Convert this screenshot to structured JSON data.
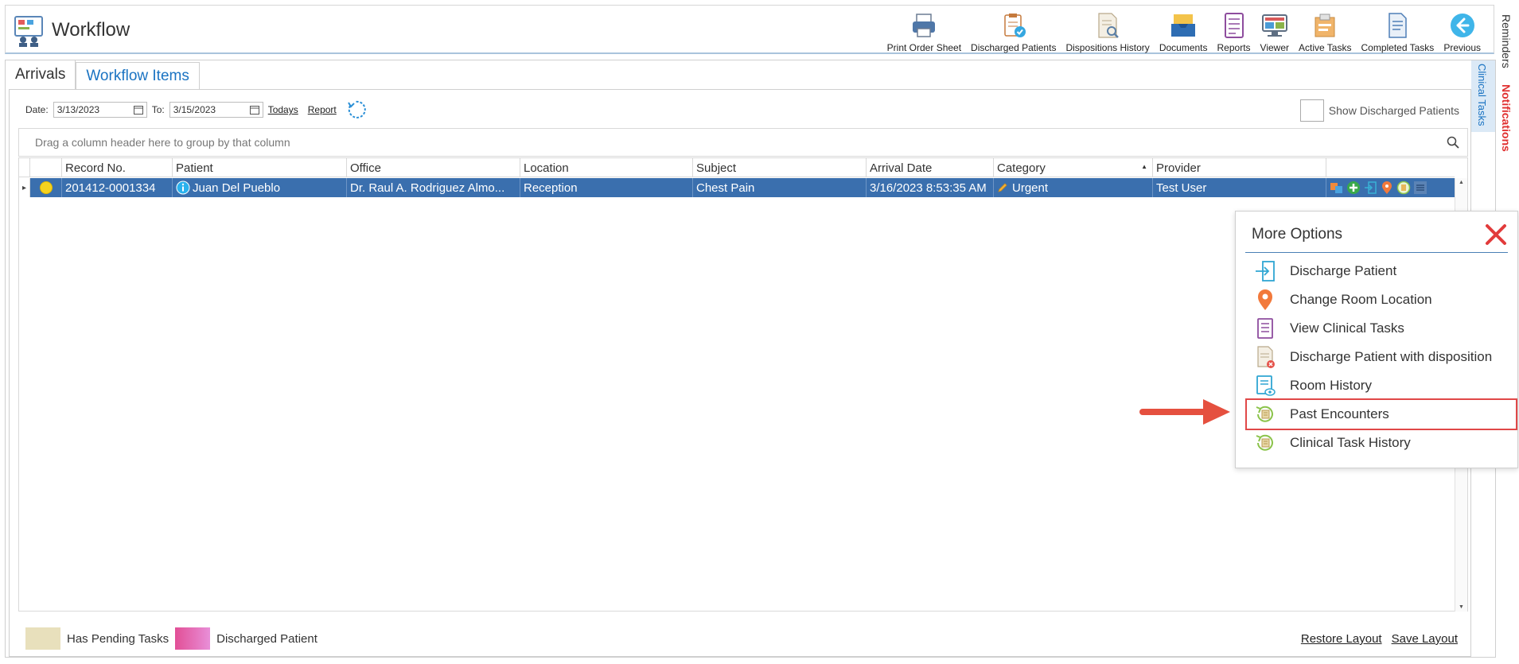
{
  "header": {
    "title": "Workflow",
    "toolbar": [
      {
        "label": "Print Order Sheet",
        "icon": "printer-icon"
      },
      {
        "label": "Discharged Patients",
        "icon": "clipboard-check-icon"
      },
      {
        "label": "Dispositions History",
        "icon": "document-search-icon"
      },
      {
        "label": "Documents",
        "icon": "inbox-tray-icon"
      },
      {
        "label": "Reports",
        "icon": "report-icon"
      },
      {
        "label": "Viewer",
        "icon": "monitor-icon"
      },
      {
        "label": "Active Tasks",
        "icon": "task-box-icon"
      },
      {
        "label": "Completed Tasks",
        "icon": "document-list-icon"
      },
      {
        "label": "Previous",
        "icon": "back-arrow-icon"
      }
    ]
  },
  "side": {
    "reminders": "Reminders",
    "notifications": "Notifications",
    "clinical_tasks": "Clinical Tasks"
  },
  "tabs": [
    {
      "label": "Arrivals",
      "active": false
    },
    {
      "label": "Workflow Items",
      "active": true
    }
  ],
  "filters": {
    "date_label": "Date:",
    "date_from": "3/13/2023",
    "to_label": "To:",
    "date_to": "3/15/2023",
    "todays_link": "Todays",
    "report_link": "Report",
    "show_discharged_label": "Show Discharged Patients"
  },
  "group_bar_hint": "Drag a column header here to group by that column",
  "grid": {
    "columns": [
      "Record No.",
      "Patient",
      "Office",
      "Location",
      "Subject",
      "Arrival Date",
      "Category",
      "Provider"
    ],
    "sort_column": "Category",
    "rows": [
      {
        "record_no": "201412-0001334",
        "patient": "Juan Del Pueblo",
        "office": "Dr. Raul A. Rodriguez Almo...",
        "location": "Reception",
        "subject": "Chest Pain",
        "arrival_date": "3/16/2023 8:53:35 AM",
        "category": "Urgent",
        "provider": "Test User",
        "status_color": "#f5d21f"
      }
    ]
  },
  "legend": [
    {
      "label": "Has Pending Tasks",
      "color": "#e8e0bc"
    },
    {
      "label": "Discharged Patient",
      "color": "#e06fb5"
    }
  ],
  "footer": {
    "restore_layout": "Restore Layout",
    "save_layout": "Save Layout"
  },
  "popup": {
    "title": "More Options",
    "items": [
      {
        "label": "Discharge Patient",
        "icon": "discharge-icon"
      },
      {
        "label": "Change Room Location",
        "icon": "location-pin-icon"
      },
      {
        "label": "View Clinical Tasks",
        "icon": "clinical-tasks-icon"
      },
      {
        "label": "Discharge Patient with disposition",
        "icon": "disposition-document-icon"
      },
      {
        "label": "Room History",
        "icon": "room-history-icon"
      },
      {
        "label": "Past Encounters",
        "icon": "past-encounters-icon",
        "highlighted": true
      },
      {
        "label": "Clinical Task History",
        "icon": "clinical-task-history-icon"
      }
    ]
  },
  "colors": {
    "accent": "#1a73c2",
    "row_selected": "#3a6fae",
    "highlight": "#e04848"
  }
}
